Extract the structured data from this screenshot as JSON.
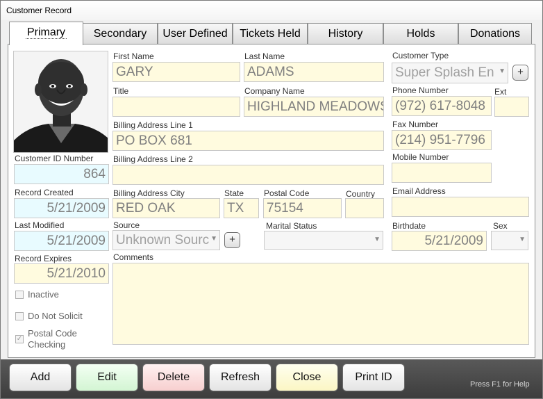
{
  "window": {
    "title": "Customer Record"
  },
  "tabs": [
    {
      "label": "Primary"
    },
    {
      "label": "Secondary"
    },
    {
      "label": "User Defined"
    },
    {
      "label": "Tickets Held"
    },
    {
      "label": "History"
    },
    {
      "label": "Holds"
    },
    {
      "label": "Donations"
    }
  ],
  "labels": {
    "first_name": "First Name",
    "last_name": "Last Name",
    "customer_type": "Customer Type",
    "title": "Title",
    "company_name": "Company Name",
    "phone_number": "Phone Number",
    "ext": "Ext",
    "billing1": "Billing Address Line 1",
    "fax_number": "Fax Number",
    "customer_id": "Customer ID Number",
    "billing2": "Billing Address Line 2",
    "mobile_number": "Mobile Number",
    "record_created": "Record Created",
    "city": "Billing Address City",
    "state": "State",
    "postal_code": "Postal Code",
    "country": "Country",
    "email": "Email Address",
    "last_modified": "Last Modified",
    "source": "Source",
    "marital_status": "Marital Status",
    "birthdate": "Birthdate",
    "sex": "Sex",
    "record_expires": "Record Expires",
    "comments": "Comments"
  },
  "values": {
    "first_name": "GARY",
    "last_name": "ADAMS",
    "customer_type": "Super Splash En",
    "title": "",
    "company_name": "HIGHLAND MEADOWS",
    "phone_number": "(972) 617-8048",
    "ext": "",
    "billing1": "PO BOX 681",
    "fax_number": "(214) 951-7796",
    "customer_id": "864",
    "billing2": "",
    "mobile_number": "",
    "record_created": "5/21/2009",
    "city": "RED OAK",
    "state": "TX",
    "postal_code": "75154",
    "country": "",
    "email": "",
    "last_modified": "5/21/2009",
    "source": "Unknown Sourc",
    "marital_status": "",
    "birthdate": "5/21/2009",
    "sex": "",
    "record_expires": "5/21/2010",
    "comments": ""
  },
  "checkboxes": {
    "inactive": {
      "label": "Inactive",
      "checked": false
    },
    "do_not_solicit": {
      "label": "Do Not Solicit",
      "checked": false
    },
    "postal_code_checking": {
      "label_line1": "Postal Code",
      "label_line2": "Checking",
      "checked": true
    }
  },
  "buttons": {
    "add": "Add",
    "edit": "Edit",
    "delete": "Delete",
    "refresh": "Refresh",
    "close": "Close",
    "print_id": "Print ID",
    "plus": "+"
  },
  "help_text": "Press F1 for Help",
  "colors": {
    "field_yellow": "#fffbdf",
    "field_blue": "#e8fbff",
    "edit_green": "#d3f5d3",
    "delete_red": "#f7cfcf",
    "close_yellow": "#fbf6c4"
  },
  "icons": {
    "dropdown": "chevron-down-icon",
    "checkmark": "checkmark-icon"
  }
}
